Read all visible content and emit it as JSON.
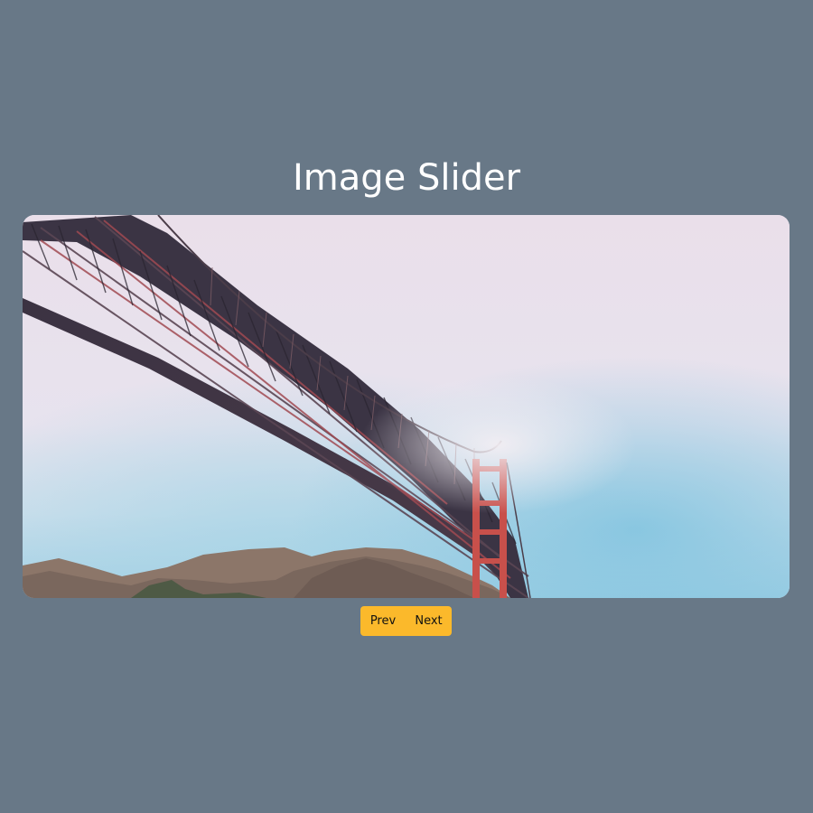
{
  "page": {
    "title": "Image Slider"
  },
  "slider": {
    "image_alt": "Golden Gate Bridge from below with fog and hills"
  },
  "controls": {
    "prev_label": "Prev",
    "next_label": "Next"
  },
  "colors": {
    "background": "#687887",
    "button": "#fbb92b",
    "title_text": "#ffffff"
  }
}
